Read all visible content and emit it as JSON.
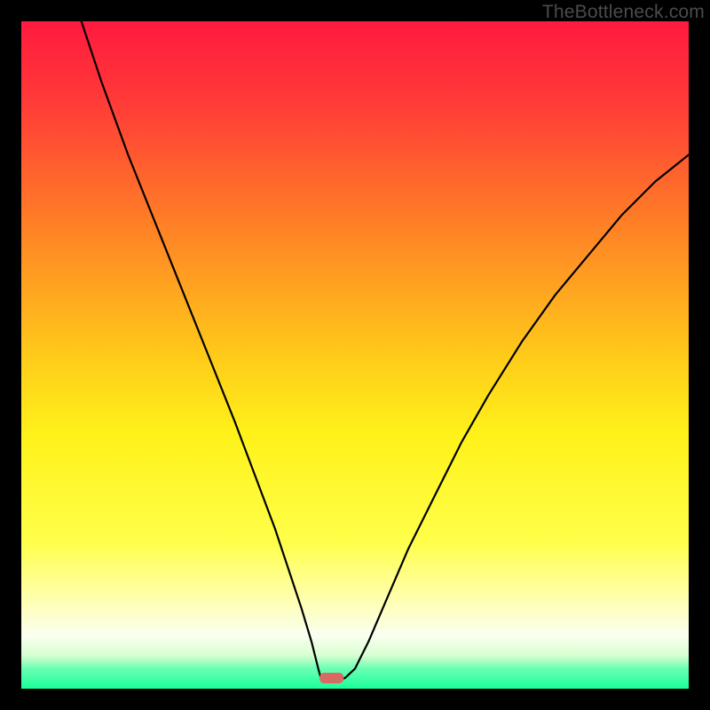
{
  "watermark": "TheBottleneck.com",
  "chart_data": {
    "type": "line",
    "title": "",
    "xlabel": "",
    "ylabel": "",
    "xlim": [
      0,
      100
    ],
    "ylim": [
      0,
      100
    ],
    "grid": false,
    "legend": false,
    "background_gradient": {
      "direction": "vertical",
      "stops": [
        {
          "pos": 0.0,
          "color": "#ff1a3e"
        },
        {
          "pos": 0.12,
          "color": "#ff3a38"
        },
        {
          "pos": 0.3,
          "color": "#ff7e26"
        },
        {
          "pos": 0.5,
          "color": "#ffca1a"
        },
        {
          "pos": 0.62,
          "color": "#fff21a"
        },
        {
          "pos": 0.78,
          "color": "#ffff4a"
        },
        {
          "pos": 0.86,
          "color": "#ffffa8"
        },
        {
          "pos": 0.92,
          "color": "#fafff0"
        },
        {
          "pos": 0.95,
          "color": "#d8ffd0"
        },
        {
          "pos": 0.97,
          "color": "#69ffb3"
        },
        {
          "pos": 1.0,
          "color": "#19ff9a"
        }
      ]
    },
    "series": [
      {
        "name": "bottleneck-curve",
        "x": [
          9,
          12,
          16,
          20,
          24,
          28,
          32,
          35,
          38,
          40,
          42,
          43.5,
          44.5,
          45,
          46,
          47,
          48.5,
          50,
          52,
          55,
          58,
          62,
          66,
          70,
          75,
          80,
          85,
          90,
          95,
          100
        ],
        "y": [
          100,
          91,
          80,
          70,
          60,
          50,
          40,
          32,
          24,
          18,
          12,
          7,
          3,
          1.2,
          1.2,
          1.2,
          1.6,
          3,
          7,
          14,
          21,
          29,
          37,
          44,
          52,
          59,
          65,
          71,
          76,
          80
        ]
      }
    ],
    "marker": {
      "name": "optimal-point",
      "x": 46.5,
      "y": 1.6,
      "width_pct": 3.6,
      "height_pct": 1.6,
      "color": "#d96a63"
    }
  }
}
